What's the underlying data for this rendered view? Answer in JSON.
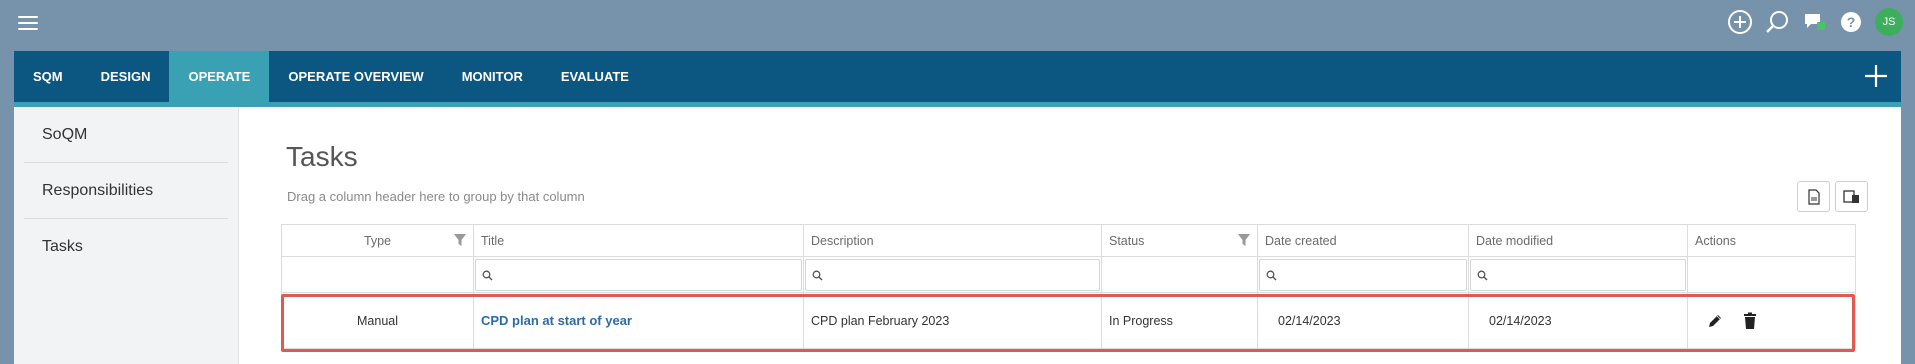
{
  "topbar": {
    "avatar_initials": "JS",
    "icons": [
      "menu-icon",
      "add-circle-icon",
      "search-icon",
      "chat-icon",
      "help-icon"
    ]
  },
  "nav": {
    "tabs": [
      {
        "label": "SQM"
      },
      {
        "label": "DESIGN"
      },
      {
        "label": "OPERATE"
      },
      {
        "label": "OPERATE OVERVIEW"
      },
      {
        "label": "MONITOR"
      },
      {
        "label": "EVALUATE"
      }
    ],
    "active_tab": "OPERATE"
  },
  "sidebar": {
    "items": [
      {
        "label": "SoQM"
      },
      {
        "label": "Responsibilities"
      },
      {
        "label": "Tasks"
      }
    ]
  },
  "main": {
    "title": "Tasks",
    "group_hint": "Drag a column header here to group by that column"
  },
  "grid": {
    "columns": [
      {
        "label": "Type"
      },
      {
        "label": "Title"
      },
      {
        "label": "Description"
      },
      {
        "label": "Status"
      },
      {
        "label": "Date created"
      },
      {
        "label": "Date modified"
      },
      {
        "label": "Actions"
      }
    ],
    "rows": [
      {
        "type": "Manual",
        "title": "CPD plan at start of year",
        "description": "CPD plan February 2023",
        "status": "In Progress",
        "date_created": "02/14/2023",
        "date_modified": "02/14/2023"
      }
    ]
  },
  "colors": {
    "background": "#7792ab",
    "nav": "#0b5782",
    "accent": "#3aa0b3",
    "link": "#2c6aa8",
    "highlight": "#e05a4f",
    "avatar": "#3dae5c"
  }
}
